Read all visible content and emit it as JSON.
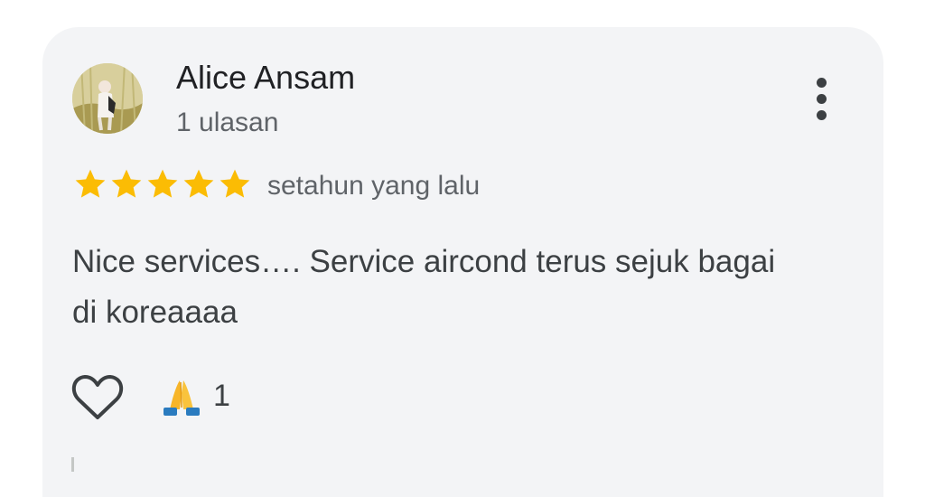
{
  "review": {
    "reviewer_name": "Alice Ansam",
    "review_count": "1 ulasan",
    "rating": 5,
    "rating_max": 5,
    "time_ago": "setahun yang lalu",
    "text": "Nice services…. Service aircond terus sejuk bagai di koreaaaa",
    "reaction_emoji": "folded-hands-icon",
    "reaction_count": "1"
  },
  "icons": {
    "more": "more-vert-icon",
    "like": "heart-outline-icon",
    "star": "star-icon"
  },
  "colors": {
    "card_background": "#f3f4f6",
    "star": "#fbbc04",
    "name": "#202124",
    "secondary_text": "#5f6368",
    "body_text": "#3c4043"
  }
}
